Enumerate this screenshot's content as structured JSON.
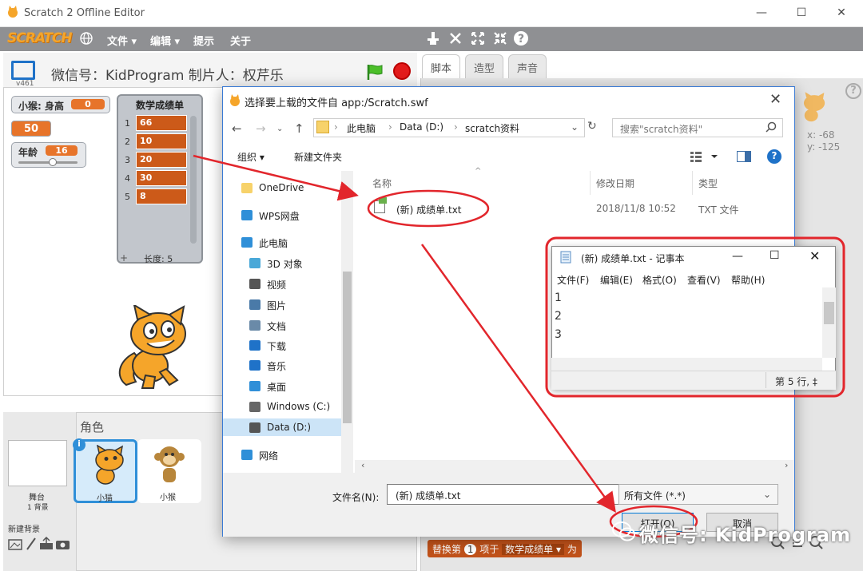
{
  "window": {
    "title": "Scratch 2 Offline Editor",
    "controls": [
      "—",
      "☐",
      "✕"
    ]
  },
  "menubar": {
    "logo": "SCRATCH",
    "items": [
      "文件 ▾",
      "编辑 ▾",
      "提示",
      "关于"
    ],
    "tools": [
      "duplicate-icon",
      "cut-icon",
      "grow-icon",
      "shrink-icon",
      "help-icon"
    ]
  },
  "stage": {
    "version": "v461",
    "project_title": "微信号：KidProgram 制片人：权芹乐",
    "monitors": [
      {
        "label": "小猴: 身高",
        "value": "0"
      },
      {
        "label": "",
        "value": "50"
      },
      {
        "label": "年龄",
        "value": "16"
      }
    ],
    "list": {
      "title": "数学成绩单",
      "items": [
        {
          "index": "1",
          "value": "66"
        },
        {
          "index": "2",
          "value": "10"
        },
        {
          "index": "3",
          "value": "20"
        },
        {
          "index": "4",
          "value": "30"
        },
        {
          "index": "5",
          "value": "8"
        }
      ],
      "add": "+",
      "length_label": "长度: 5"
    }
  },
  "sprites": {
    "header": "角色",
    "stage_label": "舞台",
    "stage_sub": "1 背景",
    "new_backdrop": "新建背景",
    "items": [
      {
        "name": "小猫",
        "selected": true
      },
      {
        "name": "小猴",
        "selected": false
      }
    ]
  },
  "right": {
    "tabs": [
      "脚本",
      "造型",
      "声音"
    ],
    "coords": [
      "x: -68",
      "y: -125"
    ],
    "block": {
      "text": "替换第",
      "num": "1",
      "mid": "项于",
      "list": "数学成绩单 ▾",
      "end": "为"
    }
  },
  "dialog": {
    "title": "选择要上载的文件自 app:/Scratch.swf",
    "close": "✕",
    "path": [
      "此电脑",
      "Data (D:)",
      "scratch资料"
    ],
    "search_placeholder": "搜索\"scratch资料\"",
    "toolbar": {
      "organize": "组织 ▾",
      "new_folder": "新建文件夹"
    },
    "nav": [
      "OneDrive",
      "WPS网盘",
      "此电脑",
      "3D 对象",
      "视频",
      "图片",
      "文档",
      "下载",
      "音乐",
      "桌面",
      "Windows (C:)",
      "Data (D:)",
      "网络"
    ],
    "columns": {
      "name": "名称",
      "date": "修改日期",
      "type": "类型"
    },
    "files": [
      {
        "name": "(新) 成绩单.txt",
        "date": "2018/11/8 10:52",
        "type": "TXT 文件"
      }
    ],
    "filename_label": "文件名(N):",
    "filename_value": "(新) 成绩单.txt",
    "filetype": "所有文件 (*.*)",
    "open_btn": "打开(O)",
    "cancel_btn": "取消"
  },
  "notepad": {
    "title": "(新) 成绩单.txt - 记事本",
    "menu": [
      "文件(F)",
      "编辑(E)",
      "格式(O)",
      "查看(V)",
      "帮助(H)"
    ],
    "lines": [
      "1",
      "2",
      "3"
    ],
    "status": "第 5 行, ‡"
  },
  "watermark": "微信号: KidProgram",
  "colors": {
    "annotation": "#e2262c",
    "accent": "#1f72c8",
    "list_item": "#cc5a19",
    "monitor_value": "#e7742a"
  }
}
